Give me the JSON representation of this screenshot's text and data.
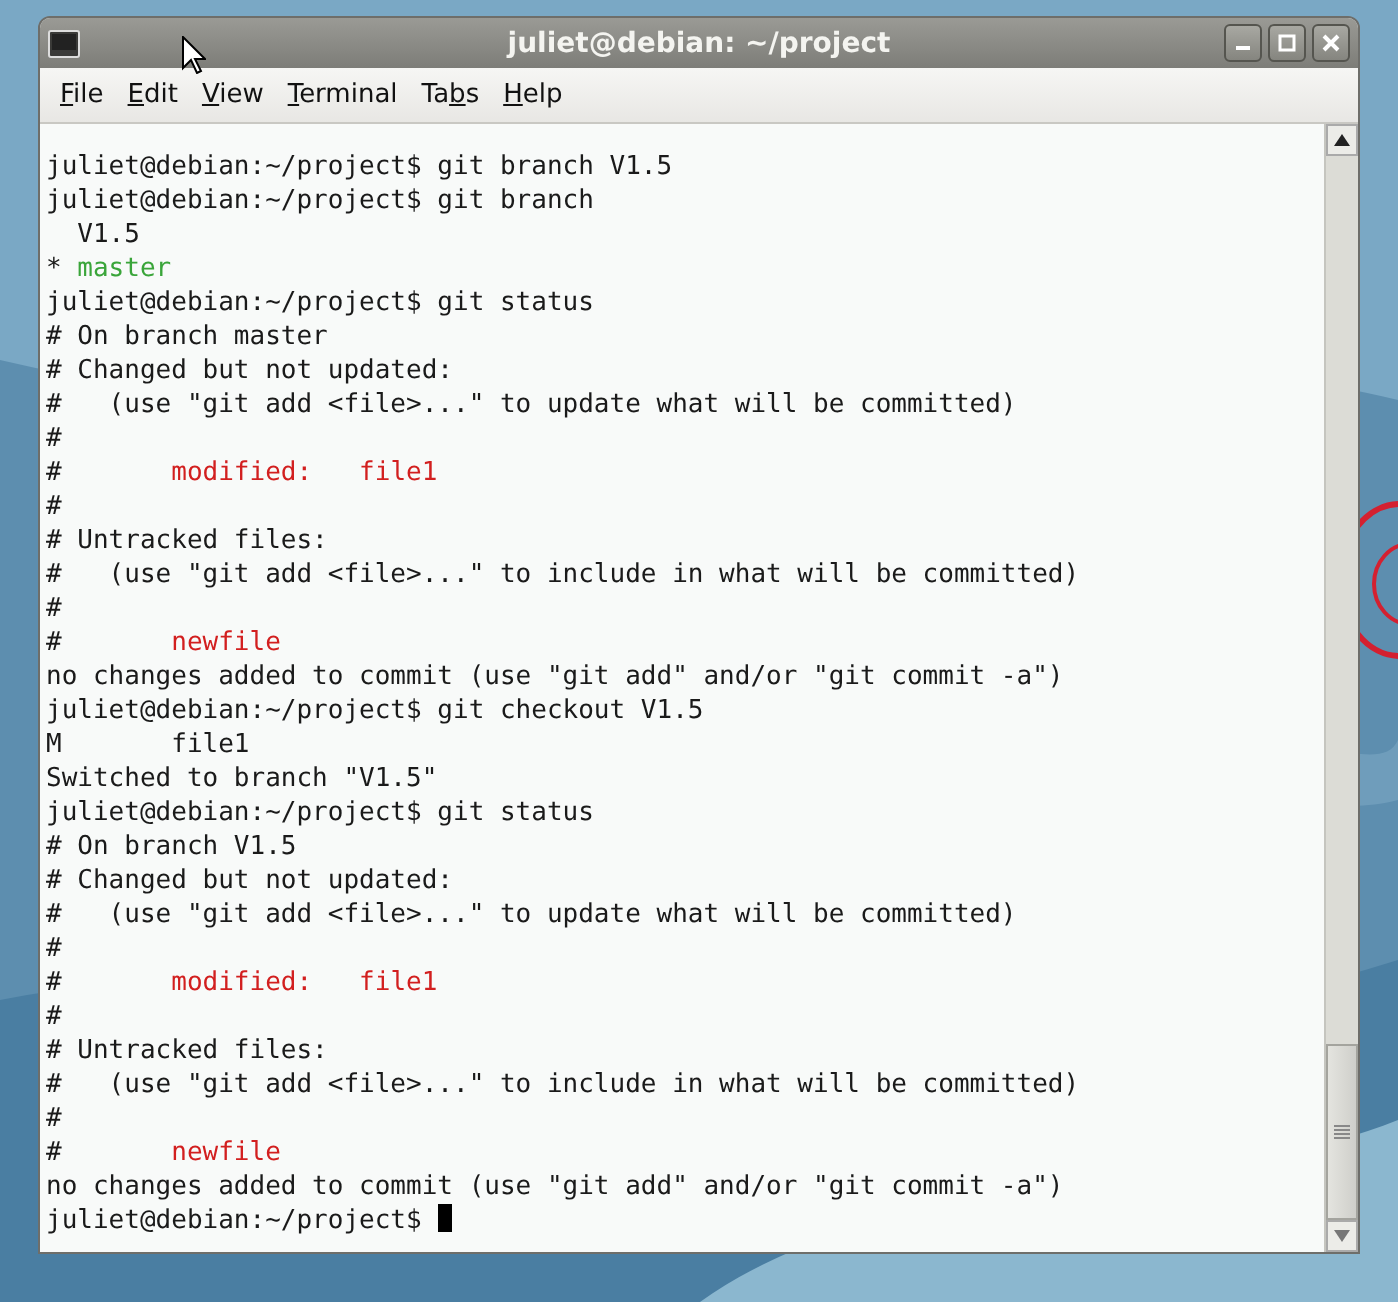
{
  "window": {
    "title": "juliet@debian: ~/project"
  },
  "menu": [
    [
      {
        "text": "F",
        "underlined": true
      },
      {
        "text": "ile",
        "underlined": false
      }
    ],
    [
      {
        "text": "E",
        "underlined": true
      },
      {
        "text": "dit",
        "underlined": false
      }
    ],
    [
      {
        "text": "V",
        "underlined": true
      },
      {
        "text": "iew",
        "underlined": false
      }
    ],
    [
      {
        "text": "T",
        "underlined": true
      },
      {
        "text": "erminal",
        "underlined": false
      }
    ],
    [
      {
        "text": "Ta",
        "underlined": false
      },
      {
        "text": "b",
        "underlined": true
      },
      {
        "text": "s",
        "underlined": false
      }
    ],
    [
      {
        "text": "H",
        "underlined": true
      },
      {
        "text": "elp",
        "underlined": false
      }
    ]
  ],
  "terminal": {
    "lines": [
      [
        {
          "text": "juliet@debian:~/project$ git branch V1.5",
          "kind": "plain"
        }
      ],
      [
        {
          "text": "juliet@debian:~/project$ git branch",
          "kind": "plain"
        }
      ],
      [
        {
          "text": "  V1.5",
          "kind": "plain"
        }
      ],
      [
        {
          "text": "* ",
          "kind": "plain"
        },
        {
          "text": "master",
          "kind": "current"
        }
      ],
      [
        {
          "text": "juliet@debian:~/project$ git status",
          "kind": "plain"
        }
      ],
      [
        {
          "text": "# On branch master",
          "kind": "plain"
        }
      ],
      [
        {
          "text": "# Changed but not updated:",
          "kind": "plain"
        }
      ],
      [
        {
          "text": "#   (use \"git add <file>...\" to update what will be committed)",
          "kind": "plain"
        }
      ],
      [
        {
          "text": "#",
          "kind": "plain"
        }
      ],
      [
        {
          "text": "#       ",
          "kind": "plain"
        },
        {
          "text": "modified:   file1",
          "kind": "changed"
        }
      ],
      [
        {
          "text": "#",
          "kind": "plain"
        }
      ],
      [
        {
          "text": "# Untracked files:",
          "kind": "plain"
        }
      ],
      [
        {
          "text": "#   (use \"git add <file>...\" to include in what will be committed)",
          "kind": "plain"
        }
      ],
      [
        {
          "text": "#",
          "kind": "plain"
        }
      ],
      [
        {
          "text": "#       ",
          "kind": "plain"
        },
        {
          "text": "newfile",
          "kind": "changed"
        }
      ],
      [
        {
          "text": "no changes added to commit (use \"git add\" and/or \"git commit -a\")",
          "kind": "plain"
        }
      ],
      [
        {
          "text": "juliet@debian:~/project$ git checkout V1.5",
          "kind": "plain"
        }
      ],
      [
        {
          "text": "M       file1",
          "kind": "plain"
        }
      ],
      [
        {
          "text": "Switched to branch \"V1.5\"",
          "kind": "plain"
        }
      ],
      [
        {
          "text": "juliet@debian:~/project$ git status",
          "kind": "plain"
        }
      ],
      [
        {
          "text": "# On branch V1.5",
          "kind": "plain"
        }
      ],
      [
        {
          "text": "# Changed but not updated:",
          "kind": "plain"
        }
      ],
      [
        {
          "text": "#   (use \"git add <file>...\" to update what will be committed)",
          "kind": "plain"
        }
      ],
      [
        {
          "text": "#",
          "kind": "plain"
        }
      ],
      [
        {
          "text": "#       ",
          "kind": "plain"
        },
        {
          "text": "modified:   file1",
          "kind": "changed"
        }
      ],
      [
        {
          "text": "#",
          "kind": "plain"
        }
      ],
      [
        {
          "text": "# Untracked files:",
          "kind": "plain"
        }
      ],
      [
        {
          "text": "#   (use \"git add <file>...\" to include in what will be committed)",
          "kind": "plain"
        }
      ],
      [
        {
          "text": "#",
          "kind": "plain"
        }
      ],
      [
        {
          "text": "#       ",
          "kind": "plain"
        },
        {
          "text": "newfile",
          "kind": "changed"
        }
      ],
      [
        {
          "text": "no changes added to commit (use \"git add\" and/or \"git commit -a\")",
          "kind": "plain"
        }
      ],
      [
        {
          "text": "juliet@debian:~/project$ ",
          "kind": "plain"
        }
      ]
    ],
    "cursor": true
  }
}
